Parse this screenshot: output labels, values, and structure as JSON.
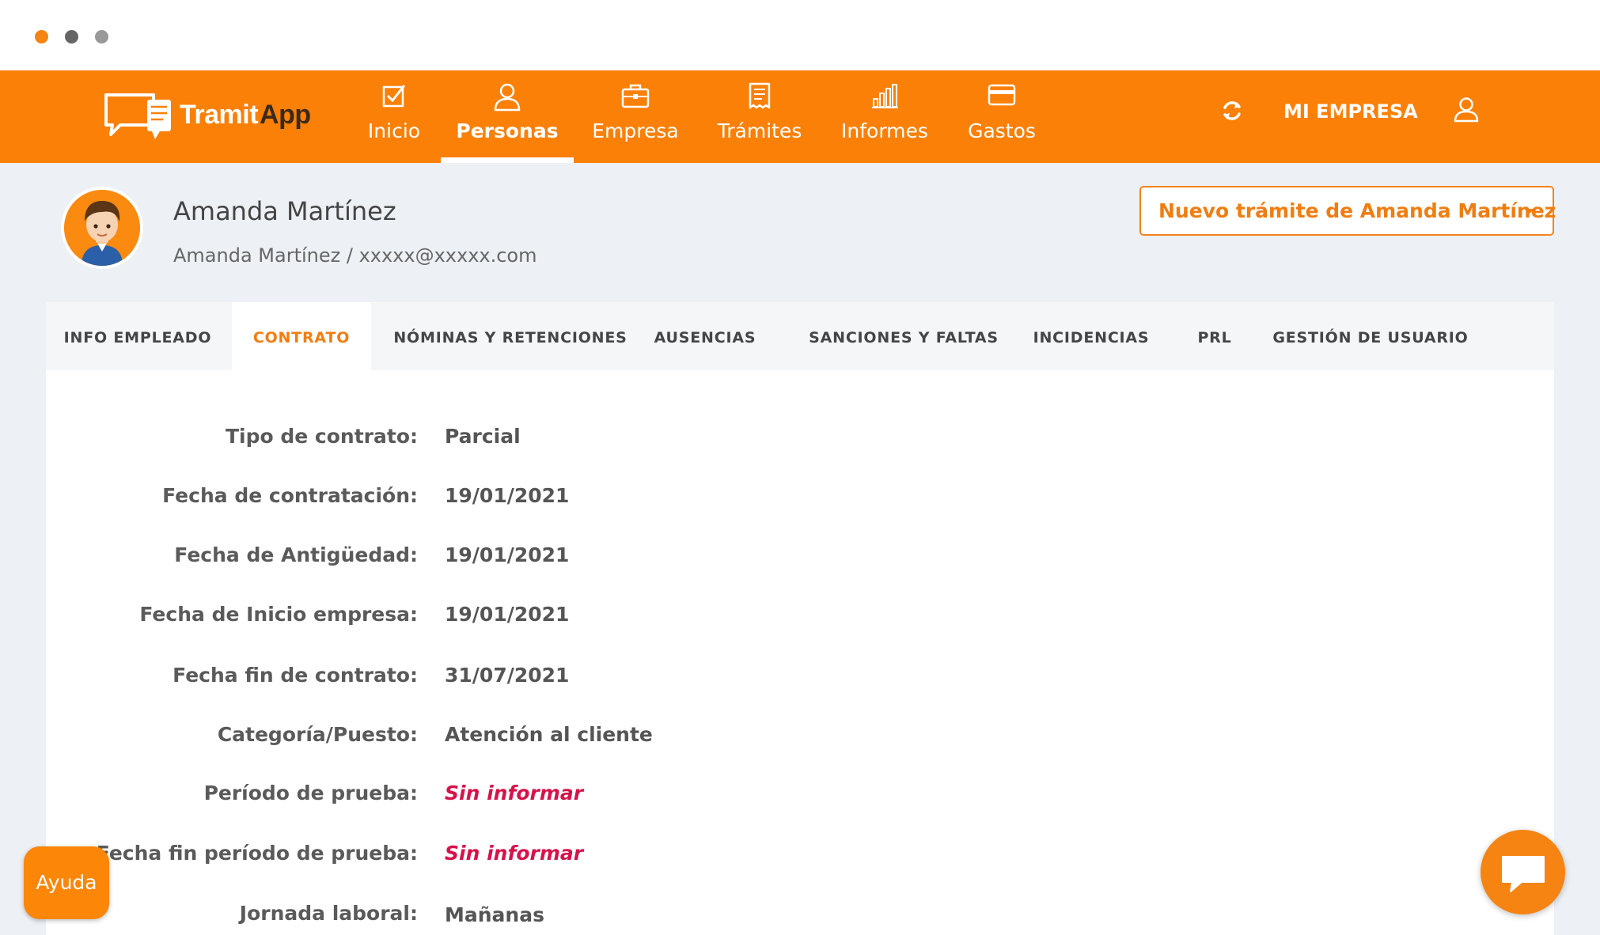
{
  "window": {
    "dot_colors": [
      "#f58412",
      "#666666",
      "#999999"
    ]
  },
  "brand": {
    "logo_word1": "Tramit",
    "logo_word2": "App",
    "accent": "#fb8007",
    "dark_accent": "#3a2a1a"
  },
  "nav": {
    "items": [
      {
        "label": "Inicio",
        "icon": "checkbox-icon"
      },
      {
        "label": "Personas",
        "icon": "person-icon",
        "active": true
      },
      {
        "label": "Empresa",
        "icon": "briefcase-icon"
      },
      {
        "label": "Trámites",
        "icon": "receipt-icon"
      },
      {
        "label": "Informes",
        "icon": "bar-chart-icon"
      },
      {
        "label": "Gastos",
        "icon": "credit-card-icon"
      }
    ],
    "company_label": "MI EMPRESA"
  },
  "employee": {
    "name": "Amanda Martínez",
    "subtitle": "Amanda Martínez / xxxxx@xxxxx.com",
    "new_procedure_button": "Nuevo trámite de Amanda Martínez"
  },
  "tabs": [
    {
      "label": "INFO EMPLEADO"
    },
    {
      "label": "CONTRATO",
      "active": true
    },
    {
      "label": "NÓMINAS Y RETENCIONES"
    },
    {
      "label": "AUSENCIAS"
    },
    {
      "label": "SANCIONES Y FALTAS"
    },
    {
      "label": "INCIDENCIAS"
    },
    {
      "label": "PRL"
    },
    {
      "label": "GESTIÓN DE USUARIO"
    }
  ],
  "contract": {
    "fields": [
      {
        "label": "Tipo de contrato:",
        "value": "Parcial"
      },
      {
        "label": "Fecha de contratación:",
        "value": "19/01/2021"
      },
      {
        "label": "Fecha de Antigüedad:",
        "value": "19/01/2021"
      },
      {
        "label": "Fecha de Inicio empresa:",
        "value": "19/01/2021"
      },
      {
        "label": "Fecha fin de contrato:",
        "value": "31/07/2021"
      },
      {
        "label": "Categoría/Puesto:",
        "value": "Atención al cliente"
      },
      {
        "label": "Período de prueba:",
        "value": "Sin informar",
        "missing": true
      },
      {
        "label": "Fecha fin período de prueba:",
        "value": "Sin informar",
        "missing": true
      },
      {
        "label": "Jornada laboral:",
        "value": "Mañanas"
      }
    ],
    "missing_color": "#d6124a"
  },
  "help": {
    "label": "Ayuda"
  }
}
